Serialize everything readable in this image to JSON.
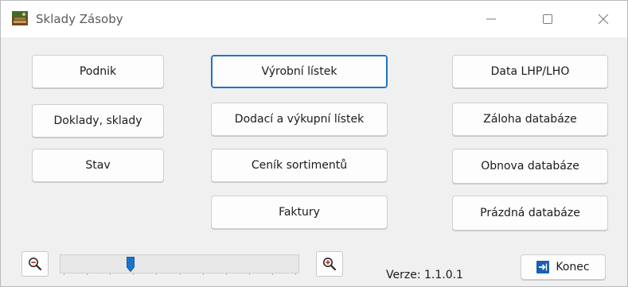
{
  "window": {
    "title": "Sklady Zásoby"
  },
  "left_column": {
    "buttons": [
      "Podnik",
      "Doklady, sklady",
      "Stav"
    ]
  },
  "middle_column": {
    "buttons": [
      "Výrobní lístek",
      "Dodací a výkupní lístek",
      "Ceník sortimentů",
      "Faktury"
    ]
  },
  "right_column": {
    "buttons": [
      "Data LHP/LHO",
      "Záloha databáze",
      "Obnova databáze",
      "Prázdná databáze"
    ]
  },
  "zoom": {
    "slider_position_fraction": 0.29,
    "zoom_out_icon": "zoom-out-icon",
    "zoom_in_icon": "zoom-in-icon"
  },
  "footer": {
    "version": "Verze: 1.1.0.1",
    "exit_label": "Konec"
  },
  "colors": {
    "accent": "#1e73c9",
    "exit_icon": "#1b5fb4"
  }
}
